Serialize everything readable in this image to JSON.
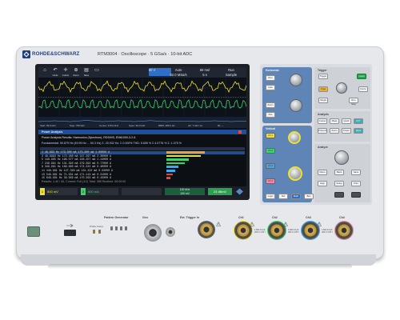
{
  "brand": {
    "name": "ROHDE&SCHWARZ",
    "model_line": "RTM3004 · Oscilloscope · 5 GSa/s · 10-bit ADC"
  },
  "screen": {
    "toolbar": {
      "icons": [
        "home-icon",
        "undo-icon",
        "cursor-icon",
        "zoom-icon",
        "save-icon",
        "mask-icon"
      ],
      "labels": [
        "",
        "Undo",
        "Cursor",
        "Zoom",
        "Save",
        ""
      ],
      "trigger_readouts": [
        {
          "top": "",
          "bottom": ""
        },
        {
          "top": "Auto",
          "bottom": "",
          "highlight": true
        },
        {
          "top": "50 ms/",
          "bottom": "5 s"
        },
        {
          "top": "Run",
          "bottom": "Sample"
        }
      ],
      "sample_readouts": [
        "60 V",
        "92.0 MSa/s",
        "5 s",
        "Sample"
      ]
    },
    "measurement_bar": [
      "Start: 99.0 kHz",
      "Stop: 750 kHz",
      "Center: 375.0 kHz",
      "Span: 99.0 kHz",
      "RBW: 488.3 Hz",
      "AF: 7.324 ms",
      "RL: --"
    ],
    "results_title": "Power Analysis",
    "results_subtitle": "Power Analysis Results: Harmonics (Spectrum), RDS/HS, EN61000-3-2 A",
    "results_summary": "Fundamental: 50.879 Hz (49.99 Hz ... 50.3 Hz) Σ: 25.932 Hz, Σ 0.000%    THD: 5.655 %  Σ 4.0776 %  Σ: 1.075 %",
    "table_rows": [
      {
        "n": "1",
        "freq": "49.993 Hz",
        "v1": "173.300 mA",
        "v2": "173.300 mA",
        "lim": "1.00000 A"
      },
      {
        "n": "3",
        "freq": "49.9993 Hz",
        "v1": "172.260 mA",
        "v2": "147.297 mA",
        "lim": "2.30000 A"
      },
      {
        "n": "5",
        "freq": "149.995 Hz",
        "v1": "198.577 mA",
        "v2": "228.257 mA",
        "lim": "1.14000 A"
      },
      {
        "n": "7",
        "freq": "249.991 Hz",
        "v1": "131.393 mA",
        "v2": "279.392 mA",
        "lim": "0.77000 A"
      },
      {
        "n": "9",
        "freq": "349.991 Hz",
        "v1": "186.880 mA",
        "v2": "174.222 mA",
        "lim": "0.40000 A"
      },
      {
        "n": "11",
        "freq": "449.991 Hz",
        "v1": "127.393 mA",
        "v2": "131.222 mA",
        "lim": "0.33000 A"
      },
      {
        "n": "13",
        "freq": "549.991 Hz",
        "v1": "71.931 mA",
        "v2": "171.113 mA",
        "lim": "0.21000 A"
      },
      {
        "n": "15",
        "freq": "649.991 Hz",
        "v1": "39.999 mA",
        "v2": "170.293 mA",
        "lim": "0.15000 A"
      }
    ],
    "result_bars": [
      0.95,
      0.85,
      0.55,
      0.45,
      0.3,
      0.22,
      0.15,
      0.1
    ],
    "footer_line": "Results: 1-40 / 40, Current: Full (1/1) Total: 385 Runtime: 00:00:00",
    "status_bar": {
      "ch1": "500 mV",
      "ch2": "500 mA",
      "math": "",
      "ref": "100 kHz\n100 mV",
      "fft": "23 dBmV"
    },
    "trace_colors": {
      "ch1": "#f0e030",
      "ch2": "#3fd070",
      "ch3": "#40a8f0",
      "ch4": "#f08aa0",
      "accent": "#2f6fc9"
    }
  },
  "panel": {
    "sections": [
      "Horizontal",
      "Trigger",
      "Vertical",
      "Analysis",
      "Analyze"
    ],
    "horizontal_keys": [
      "Run",
      "Auto",
      "Zoom",
      "Pos"
    ],
    "trigger_keys": [
      "Trigger",
      "Level",
      "Type",
      "Single",
      "Run Stop",
      "Force"
    ],
    "vertical_keys": [
      "Ch 1",
      "Ch 2",
      "Ch 3",
      "Ch 4",
      "Logic",
      "Ref",
      "Math",
      "Bus"
    ],
    "analysis_keys": [
      "Cursor",
      "Meas",
      "Quick",
      "FFT",
      "Protocol",
      "Zoom",
      "Power",
      "Apps"
    ],
    "analyze_keys": [
      "Menu",
      "Back",
      "Save",
      "Help",
      "Setup",
      "Print"
    ]
  },
  "front": {
    "usb_label": "",
    "pattern_generator_label": "Pattern Generator",
    "pattern_generator_sublabel": "Probe Comp.",
    "gen_label": "Gen",
    "ext_trigger_label": "Ext. Trigger In",
    "channels": [
      "Ch1",
      "Ch2",
      "Ch3",
      "Ch4"
    ],
    "channel_rating": "1 MΩ 13 pF\n300 V CAT I",
    "power_button": ""
  }
}
